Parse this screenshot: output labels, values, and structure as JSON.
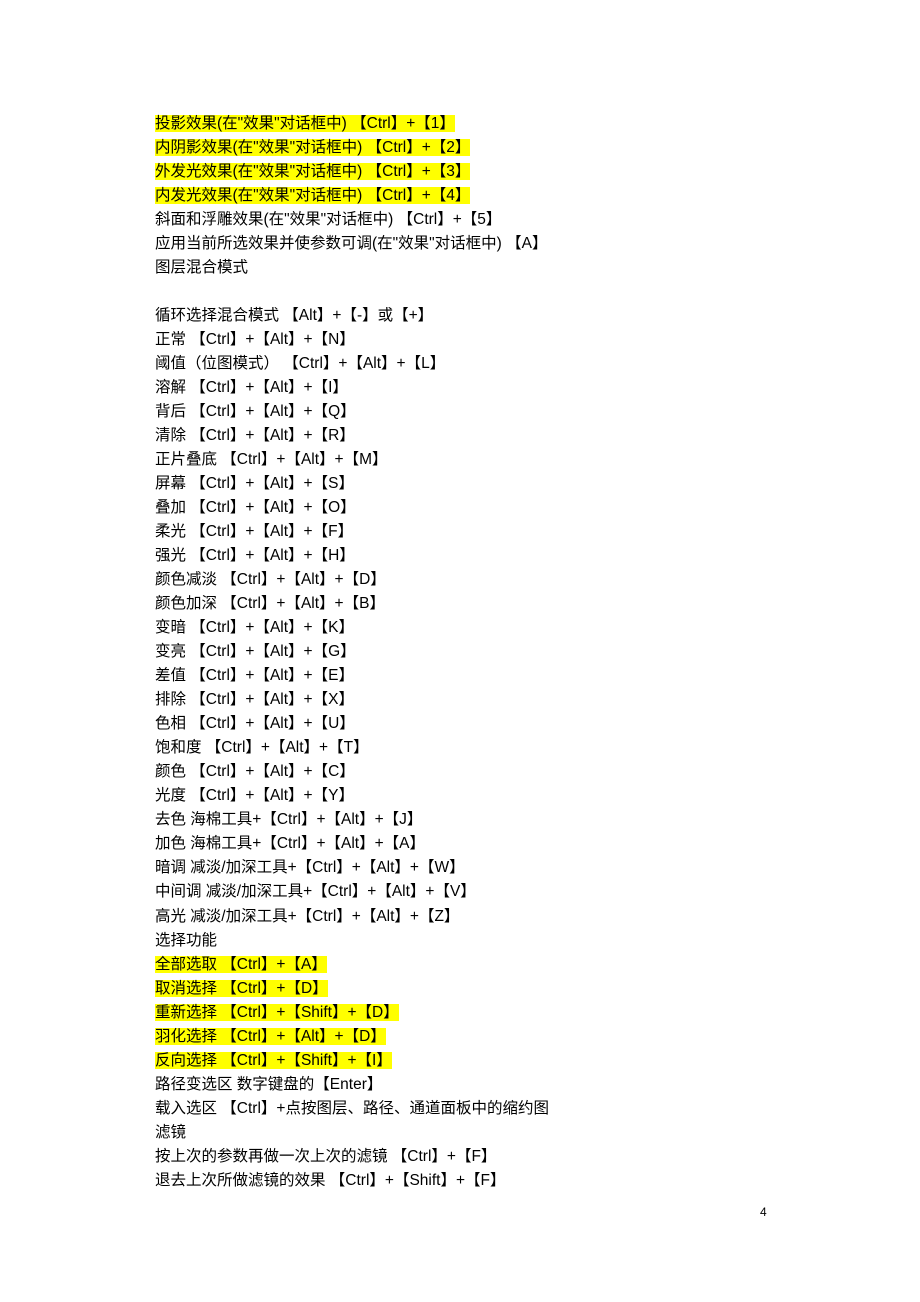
{
  "page_number": "4",
  "lines": [
    {
      "text": "投影效果(在\"效果\"对话框中) 【Ctrl】+【1】 ",
      "hl": true
    },
    {
      "text": "内阴影效果(在\"效果\"对话框中) 【Ctrl】+【2】 ",
      "hl": true
    },
    {
      "text": "外发光效果(在\"效果\"对话框中) 【Ctrl】+【3】 ",
      "hl": true
    },
    {
      "text": "内发光效果(在\"效果\"对话框中) 【Ctrl】+【4】 ",
      "hl": true
    },
    {
      "text": "斜面和浮雕效果(在\"效果\"对话框中) 【Ctrl】+【5】"
    },
    {
      "text": "应用当前所选效果并使参数可调(在\"效果\"对话框中) 【A】"
    },
    {
      "text": "图层混合模式"
    },
    {
      "break": true
    },
    {
      "text": "循环选择混合模式 【Alt】+【-】或【+】"
    },
    {
      "text": "正常 【Ctrl】+【Alt】+【N】"
    },
    {
      "text": "阈值（位图模式） 【Ctrl】+【Alt】+【L】"
    },
    {
      "text": "溶解 【Ctrl】+【Alt】+【I】"
    },
    {
      "text": "背后 【Ctrl】+【Alt】+【Q】"
    },
    {
      "text": "清除 【Ctrl】+【Alt】+【R】"
    },
    {
      "text": "正片叠底 【Ctrl】+【Alt】+【M】"
    },
    {
      "text": "屏幕 【Ctrl】+【Alt】+【S】"
    },
    {
      "text": "叠加 【Ctrl】+【Alt】+【O】"
    },
    {
      "text": "柔光 【Ctrl】+【Alt】+【F】"
    },
    {
      "text": "强光 【Ctrl】+【Alt】+【H】"
    },
    {
      "text": "颜色减淡 【Ctrl】+【Alt】+【D】"
    },
    {
      "text": "颜色加深 【Ctrl】+【Alt】+【B】"
    },
    {
      "text": "变暗 【Ctrl】+【Alt】+【K】"
    },
    {
      "text": "变亮 【Ctrl】+【Alt】+【G】"
    },
    {
      "text": "差值 【Ctrl】+【Alt】+【E】"
    },
    {
      "text": "排除 【Ctrl】+【Alt】+【X】"
    },
    {
      "text": "色相 【Ctrl】+【Alt】+【U】"
    },
    {
      "text": "饱和度 【Ctrl】+【Alt】+【T】"
    },
    {
      "text": "颜色 【Ctrl】+【Alt】+【C】"
    },
    {
      "text": "光度 【Ctrl】+【Alt】+【Y】"
    },
    {
      "text": "去色 海棉工具+【Ctrl】+【Alt】+【J】"
    },
    {
      "text": "加色 海棉工具+【Ctrl】+【Alt】+【A】"
    },
    {
      "text": "暗调 减淡/加深工具+【Ctrl】+【Alt】+【W】"
    },
    {
      "text": "中间调 减淡/加深工具+【Ctrl】+【Alt】+【V】"
    },
    {
      "text": "高光 减淡/加深工具+【Ctrl】+【Alt】+【Z】"
    },
    {
      "text": "选择功能"
    },
    {
      "text": "全部选取 【Ctrl】+【A】 ",
      "hl": true
    },
    {
      "text": "取消选择 【Ctrl】+【D】 ",
      "hl": true
    },
    {
      "text": "重新选择 【Ctrl】+【Shift】+【D】 ",
      "hl": true
    },
    {
      "text": "羽化选择 【Ctrl】+【Alt】+【D】 ",
      "hl": true
    },
    {
      "text": "反向选择 【Ctrl】+【Shift】+【I】 ",
      "hl": true
    },
    {
      "text": "路径变选区 数字键盘的【Enter】"
    },
    {
      "text": "载入选区 【Ctrl】+点按图层、路径、通道面板中的缩约图"
    },
    {
      "text": "滤镜"
    },
    {
      "text": "按上次的参数再做一次上次的滤镜 【Ctrl】+【F】"
    },
    {
      "text": "退去上次所做滤镜的效果 【Ctrl】+【Shift】+【F】"
    }
  ]
}
